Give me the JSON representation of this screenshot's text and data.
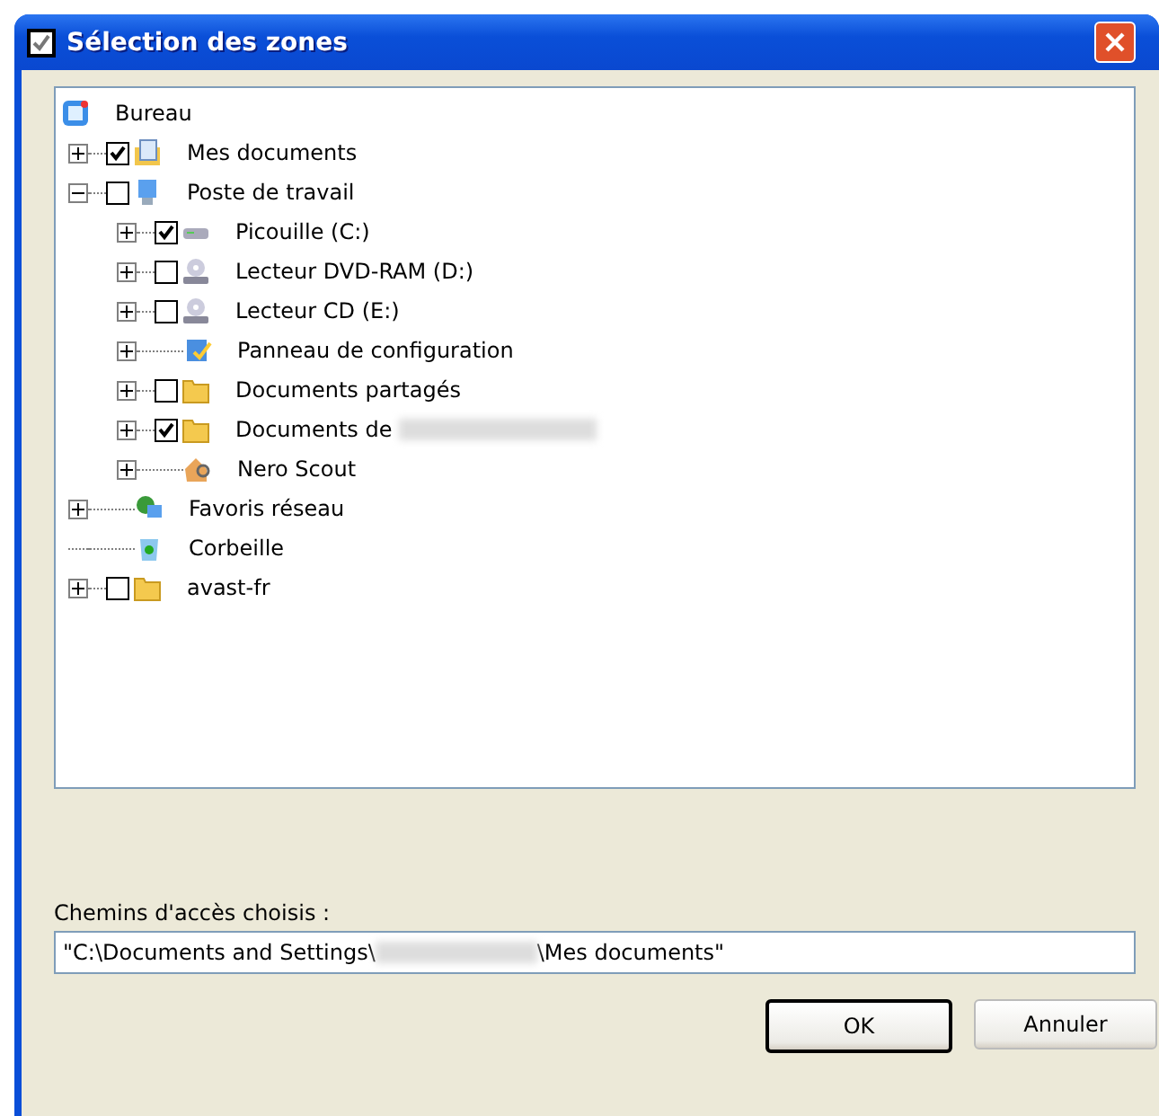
{
  "window": {
    "title": "Sélection des zones"
  },
  "tree": [
    {
      "label": "Bureau",
      "kind": "desktop",
      "children": [
        {
          "label": "Mes documents",
          "kind": "documents",
          "expanded": false,
          "checked": true
        },
        {
          "label": "Poste de travail",
          "kind": "computer",
          "expanded": true,
          "checked": false,
          "children": [
            {
              "label": "Picouille (C:)",
              "kind": "drive",
              "expanded": false,
              "checked": true
            },
            {
              "label": "Lecteur DVD-RAM (D:)",
              "kind": "cd",
              "expanded": false,
              "checked": false
            },
            {
              "label": "Lecteur CD (E:)",
              "kind": "cd",
              "expanded": false,
              "checked": false
            },
            {
              "label": "Panneau de configuration",
              "kind": "control-panel",
              "expanded": false
            },
            {
              "label": "Documents partagés",
              "kind": "folder",
              "expanded": false,
              "checked": false
            },
            {
              "label": "Documents de",
              "kind": "folder",
              "expanded": false,
              "checked": true,
              "redacted": true
            },
            {
              "label": "Nero Scout",
              "kind": "house",
              "expanded": false
            }
          ]
        },
        {
          "label": "Favoris réseau",
          "kind": "network",
          "expanded": false
        },
        {
          "label": "Corbeille",
          "kind": "recycle"
        },
        {
          "label": "avast-fr",
          "kind": "folder",
          "expanded": false,
          "checked": false
        }
      ]
    }
  ],
  "path_label": "Chemins d'accès choisis :",
  "path": {
    "before": "\"C:\\Documents and Settings\\",
    "redacted": true,
    "after": "\\Mes documents\""
  },
  "buttons": [
    {
      "label": "OK",
      "default": true
    },
    {
      "label": "Annuler",
      "default": false
    }
  ]
}
